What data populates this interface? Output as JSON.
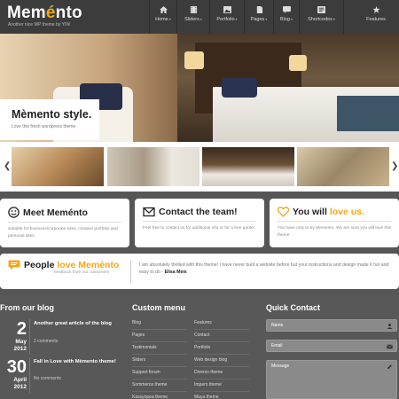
{
  "header": {
    "logo_text_pre": "Mem",
    "logo_text_accent": "é",
    "logo_text_post": "nto",
    "tagline": "Another nice WP theme by YIW",
    "nav": [
      {
        "label": "Home",
        "icon": "home-icon",
        "dropdown": true
      },
      {
        "label": "Sliders",
        "icon": "film-icon",
        "dropdown": true
      },
      {
        "label": "Portfolio",
        "icon": "image-icon",
        "dropdown": true
      },
      {
        "label": "Pages",
        "icon": "page-icon",
        "dropdown": true
      },
      {
        "label": "Blog",
        "icon": "chat-icon",
        "dropdown": true
      },
      {
        "label": "Shortcodes",
        "icon": "code-icon",
        "dropdown": true
      },
      {
        "label": "Features",
        "icon": "star-icon",
        "dropdown": false
      }
    ]
  },
  "hero": {
    "caption_title": "Mèmento style.",
    "caption_text": "Love this fresh wordpress theme"
  },
  "slider": {
    "prev_label": "❮",
    "next_label": "❯",
    "thumbs": [
      "bedroom-thumb",
      "couple-thumb",
      "bed-thumb",
      "woman-thumb"
    ]
  },
  "features": [
    {
      "title_pre": "Meet Meménto",
      "title_hl": "",
      "icon": "smile-icon",
      "text": "suitable for business/corporate sites, creative portfolio and personal sites."
    },
    {
      "title_pre": "Contact the team!",
      "title_hl": "",
      "icon": "mail-icon",
      "text": "Feel free to contact us for additional info or for a free quote!"
    },
    {
      "title_pre": "You will ",
      "title_hl": "love us.",
      "icon": "heart-icon",
      "text": "You have only to try Memento. We are sure you will love this theme."
    }
  ],
  "testimonial": {
    "title_pre": "People ",
    "title_hl": "love Memènto",
    "subtitle": "feedback from our customers",
    "quote": "I am absolutely thrilled with this theme! I have never built a website before but your instructions and design made it fun and easy to do -",
    "author": "Elisa Meis",
    "icon": "speech-icon"
  },
  "footer": {
    "blog_title": "From our blog",
    "posts": [
      {
        "day": "2",
        "month": "May",
        "year": "2012",
        "title": "Another great article of the blog",
        "meta": "2 comments"
      },
      {
        "day": "30",
        "month": "April",
        "year": "2012",
        "title": "Fall in Love with Mèmento theme!",
        "meta": "No comments"
      }
    ],
    "menu_title": "Custom menu",
    "menu_col1": [
      "Blog",
      "Pages",
      "Testimonials",
      "Sliders",
      "Support forum",
      "Sommerce theme",
      "Kassyopea theme"
    ],
    "menu_col2": [
      "Features",
      "Contact",
      "Portfolio",
      "Web design blog",
      "Diverso theme",
      "Impero theme",
      "Maya theme"
    ],
    "contact_title": "Quick Contact",
    "fields": [
      {
        "label": "Name",
        "icon": "user-icon"
      },
      {
        "label": "Email",
        "icon": "envelope-icon"
      },
      {
        "label": "Message",
        "icon": "pencil-icon"
      }
    ]
  },
  "colors": {
    "accent": "#f0a818",
    "header_bg": "#3c3c3c",
    "page_bg": "#565656"
  }
}
